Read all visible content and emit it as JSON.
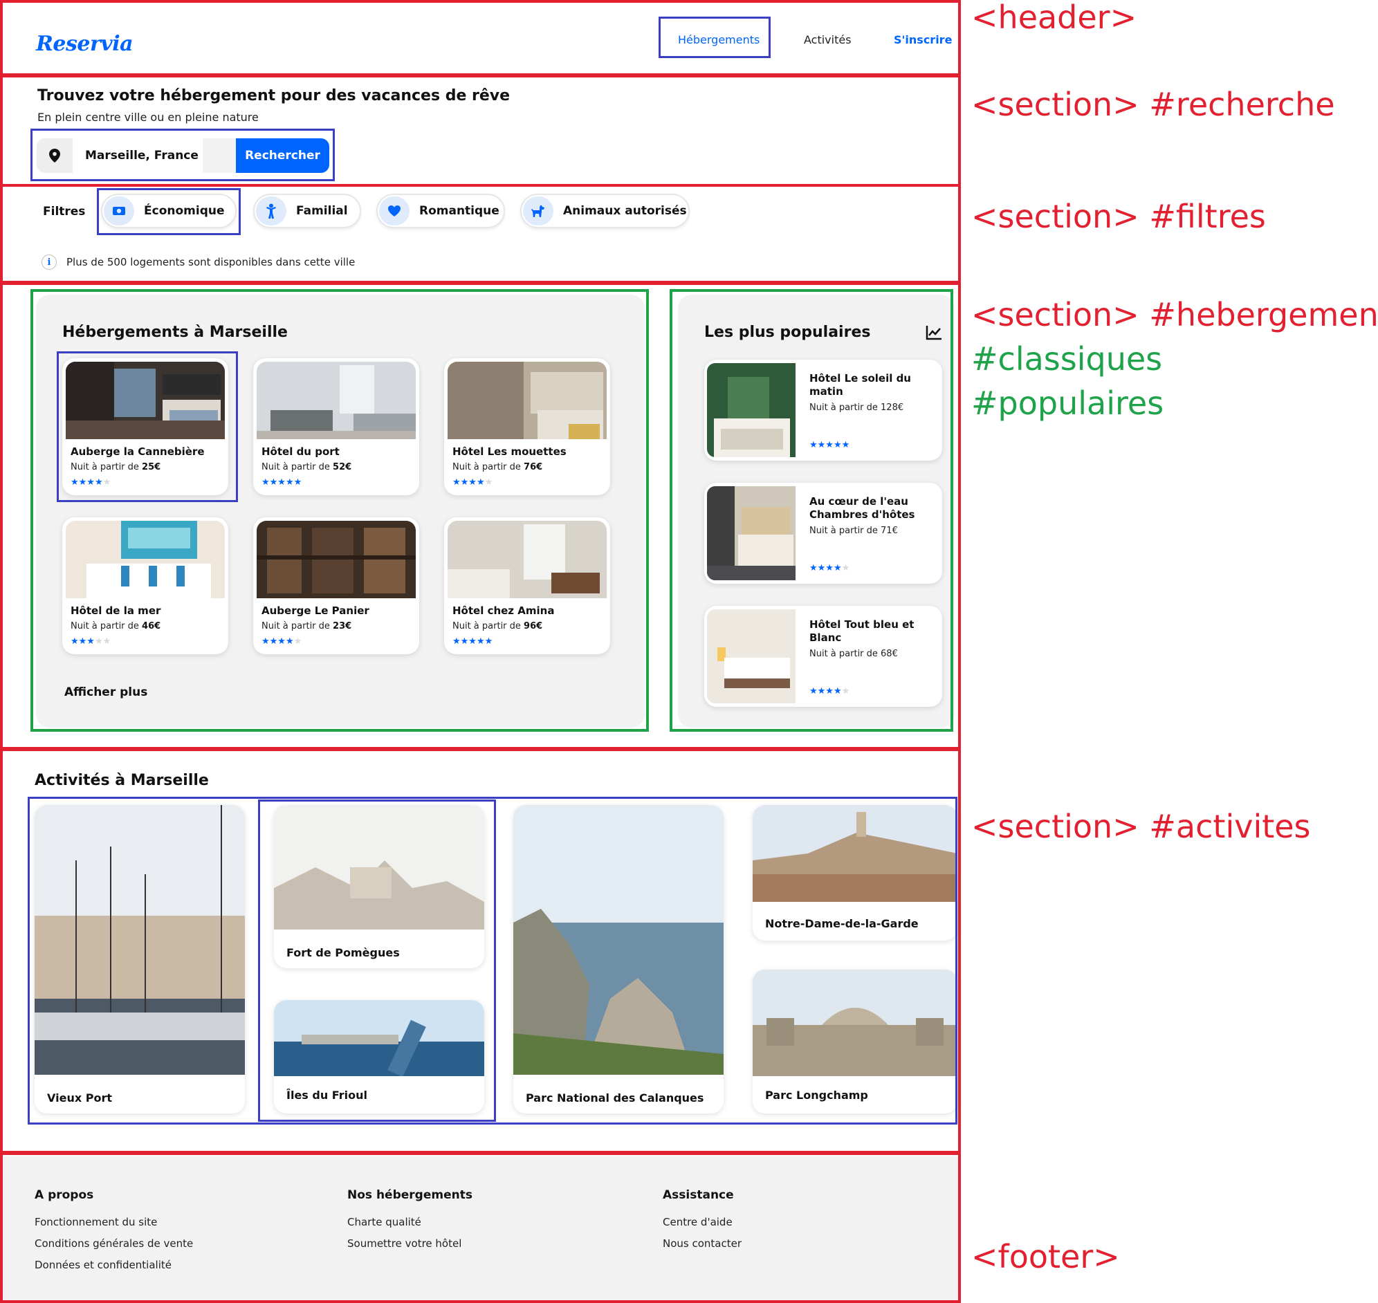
{
  "header": {
    "logo": "Reservia",
    "nav": {
      "hebergements": "Hébergements",
      "activites": "Activités",
      "inscrire": "S'inscrire"
    }
  },
  "recherche": {
    "title": "Trouvez votre hébergement pour des vacances de rêve",
    "subtitle": "En plein centre ville ou en pleine nature",
    "input_value": "Marseille, France",
    "button": "Rechercher"
  },
  "filtres": {
    "label": "Filtres",
    "chips": [
      "Économique",
      "Familial",
      "Romantique",
      "Animaux autorisés"
    ],
    "info": "Plus de 500 logements sont disponibles dans cette ville"
  },
  "classiques": {
    "title": "Hébergements à Marseille",
    "price_prefix": "Nuit à partir de",
    "more": "Afficher plus",
    "cards": [
      {
        "name": "Auberge la Cannebière",
        "price": "25€",
        "stars": 4
      },
      {
        "name": "Hôtel du port",
        "price": "52€",
        "stars": 5
      },
      {
        "name": "Hôtel Les mouettes",
        "price": "76€",
        "stars": 4
      },
      {
        "name": "Hôtel de la mer",
        "price": "46€",
        "stars": 3
      },
      {
        "name": "Auberge Le Panier",
        "price": "23€",
        "stars": 4
      },
      {
        "name": "Hôtel chez Amina",
        "price": "96€",
        "stars": 5
      }
    ]
  },
  "populaires": {
    "title": "Les plus populaires",
    "cards": [
      {
        "name": "Hôtel Le soleil du matin",
        "price": "Nuit à partir de 128€",
        "stars": 5
      },
      {
        "name": "Au cœur de l'eau Chambres d'hôtes",
        "price": "Nuit à partir de 71€",
        "stars": 4
      },
      {
        "name": "Hôtel Tout bleu et Blanc",
        "price": "Nuit à partir de 68€",
        "stars": 4
      }
    ]
  },
  "activites": {
    "title": "Activités à Marseille",
    "items": [
      "Vieux Port",
      "Fort de Pomègues",
      "Îles du Frioul",
      "Parc National des Calanques",
      "Notre-Dame-de-la-Garde",
      "Parc Longchamp"
    ]
  },
  "footer": {
    "col1": {
      "title": "A propos",
      "links": [
        "Fonctionnement du site",
        "Conditions générales de vente",
        "Données et confidentialité"
      ]
    },
    "col2": {
      "title": "Nos hébergements",
      "links": [
        "Charte qualité",
        "Soumettre votre hôtel"
      ]
    },
    "col3": {
      "title": "Assistance",
      "links": [
        "Centre d'aide",
        "Nous contacter"
      ]
    }
  },
  "annotations": {
    "header": "<header>",
    "recherche": "<section> #recherche",
    "filtres": "<section> #filtres",
    "hebergements": "<section> #hebergements",
    "classiques": "#classiques",
    "populaires": "#populaires",
    "activites": "<section> #activites",
    "footer": "<footer>"
  },
  "colors": {
    "accent": "#0065fc",
    "annotation_red": "#e32030",
    "annotation_green": "#1fa34a",
    "annotation_blue": "#3a3fc4"
  }
}
